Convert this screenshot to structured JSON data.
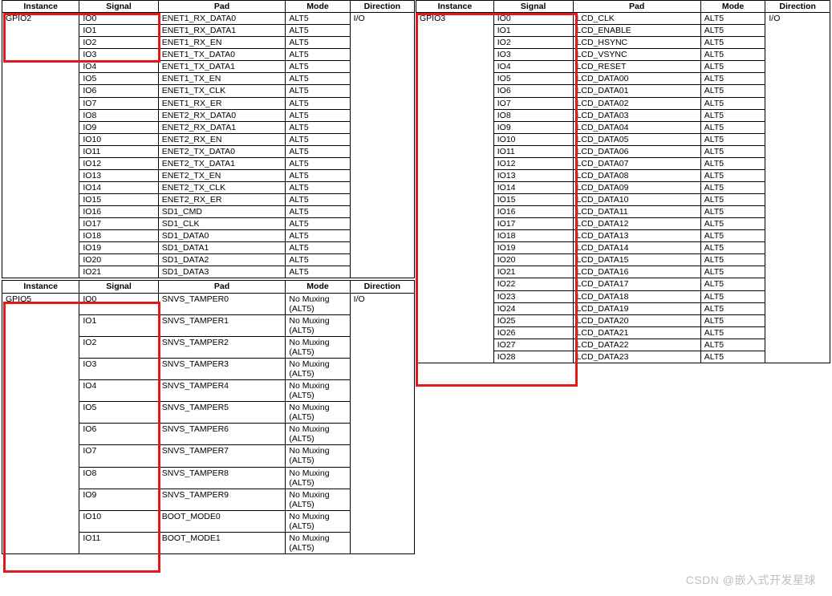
{
  "headers": {
    "instance": "Instance",
    "signal": "Signal",
    "pad": "Pad",
    "mode": "Mode",
    "direction": "Direction"
  },
  "watermark": "CSDN @嵌入式开发星球",
  "tables": {
    "t1": {
      "instance": "GPIO2",
      "direction": "I/O",
      "rows": [
        {
          "sig": "IO0",
          "pad": "ENET1_RX_DATA0",
          "mode": "ALT5"
        },
        {
          "sig": "IO1",
          "pad": "ENET1_RX_DATA1",
          "mode": "ALT5"
        },
        {
          "sig": "IO2",
          "pad": "ENET1_RX_EN",
          "mode": "ALT5"
        },
        {
          "sig": "IO3",
          "pad": "ENET1_TX_DATA0",
          "mode": "ALT5"
        },
        {
          "sig": "IO4",
          "pad": "ENET1_TX_DATA1",
          "mode": "ALT5"
        },
        {
          "sig": "IO5",
          "pad": "ENET1_TX_EN",
          "mode": "ALT5"
        },
        {
          "sig": "IO6",
          "pad": "ENET1_TX_CLK",
          "mode": "ALT5"
        },
        {
          "sig": "IO7",
          "pad": "ENET1_RX_ER",
          "mode": "ALT5"
        },
        {
          "sig": "IO8",
          "pad": "ENET2_RX_DATA0",
          "mode": "ALT5"
        },
        {
          "sig": "IO9",
          "pad": "ENET2_RX_DATA1",
          "mode": "ALT5"
        },
        {
          "sig": "IO10",
          "pad": "ENET2_RX_EN",
          "mode": "ALT5"
        },
        {
          "sig": "IO11",
          "pad": "ENET2_TX_DATA0",
          "mode": "ALT5"
        },
        {
          "sig": "IO12",
          "pad": "ENET2_TX_DATA1",
          "mode": "ALT5"
        },
        {
          "sig": "IO13",
          "pad": "ENET2_TX_EN",
          "mode": "ALT5"
        },
        {
          "sig": "IO14",
          "pad": "ENET2_TX_CLK",
          "mode": "ALT5"
        },
        {
          "sig": "IO15",
          "pad": "ENET2_RX_ER",
          "mode": "ALT5"
        },
        {
          "sig": "IO16",
          "pad": "SD1_CMD",
          "mode": "ALT5"
        },
        {
          "sig": "IO17",
          "pad": "SD1_CLK",
          "mode": "ALT5"
        },
        {
          "sig": "IO18",
          "pad": "SD1_DATA0",
          "mode": "ALT5"
        },
        {
          "sig": "IO19",
          "pad": "SD1_DATA1",
          "mode": "ALT5"
        },
        {
          "sig": "IO20",
          "pad": "SD1_DATA2",
          "mode": "ALT5"
        },
        {
          "sig": "IO21",
          "pad": "SD1_DATA3",
          "mode": "ALT5"
        }
      ]
    },
    "t2": {
      "instance": "GPIO5",
      "direction": "I/O",
      "rows": [
        {
          "sig": "IO0",
          "pad": "SNVS_TAMPER0",
          "mode": "No Muxing (ALT5)"
        },
        {
          "sig": "IO1",
          "pad": "SNVS_TAMPER1",
          "mode": "No Muxing (ALT5)"
        },
        {
          "sig": "IO2",
          "pad": "SNVS_TAMPER2",
          "mode": "No Muxing (ALT5)"
        },
        {
          "sig": "IO3",
          "pad": "SNVS_TAMPER3",
          "mode": "No Muxing (ALT5)"
        },
        {
          "sig": "IO4",
          "pad": "SNVS_TAMPER4",
          "mode": "No Muxing (ALT5)"
        },
        {
          "sig": "IO5",
          "pad": "SNVS_TAMPER5",
          "mode": "No Muxing (ALT5)"
        },
        {
          "sig": "IO6",
          "pad": "SNVS_TAMPER6",
          "mode": "No Muxing (ALT5)"
        },
        {
          "sig": "IO7",
          "pad": "SNVS_TAMPER7",
          "mode": "No Muxing (ALT5)"
        },
        {
          "sig": "IO8",
          "pad": "SNVS_TAMPER8",
          "mode": "No Muxing (ALT5)"
        },
        {
          "sig": "IO9",
          "pad": "SNVS_TAMPER9",
          "mode": "No Muxing (ALT5)"
        },
        {
          "sig": "IO10",
          "pad": "BOOT_MODE0",
          "mode": "No Muxing (ALT5)"
        },
        {
          "sig": "IO11",
          "pad": "BOOT_MODE1",
          "mode": "No Muxing (ALT5)"
        }
      ]
    },
    "t3": {
      "instance": "GPIO3",
      "direction": "I/O",
      "rows": [
        {
          "sig": "IO0",
          "pad": "LCD_CLK",
          "mode": "ALT5"
        },
        {
          "sig": "IO1",
          "pad": "LCD_ENABLE",
          "mode": "ALT5"
        },
        {
          "sig": "IO2",
          "pad": "LCD_HSYNC",
          "mode": "ALT5"
        },
        {
          "sig": "IO3",
          "pad": "LCD_VSYNC",
          "mode": "ALT5"
        },
        {
          "sig": "IO4",
          "pad": "LCD_RESET",
          "mode": "ALT5"
        },
        {
          "sig": "IO5",
          "pad": "LCD_DATA00",
          "mode": "ALT5"
        },
        {
          "sig": "IO6",
          "pad": "LCD_DATA01",
          "mode": "ALT5"
        },
        {
          "sig": "IO7",
          "pad": "LCD_DATA02",
          "mode": "ALT5"
        },
        {
          "sig": "IO8",
          "pad": "LCD_DATA03",
          "mode": "ALT5"
        },
        {
          "sig": "IO9",
          "pad": "LCD_DATA04",
          "mode": "ALT5"
        },
        {
          "sig": "IO10",
          "pad": "LCD_DATA05",
          "mode": "ALT5"
        },
        {
          "sig": "IO11",
          "pad": "LCD_DATA06",
          "mode": "ALT5"
        },
        {
          "sig": "IO12",
          "pad": "LCD_DATA07",
          "mode": "ALT5"
        },
        {
          "sig": "IO13",
          "pad": "LCD_DATA08",
          "mode": "ALT5"
        },
        {
          "sig": "IO14",
          "pad": "LCD_DATA09",
          "mode": "ALT5"
        },
        {
          "sig": "IO15",
          "pad": "LCD_DATA10",
          "mode": "ALT5"
        },
        {
          "sig": "IO16",
          "pad": "LCD_DATA11",
          "mode": "ALT5"
        },
        {
          "sig": "IO17",
          "pad": "LCD_DATA12",
          "mode": "ALT5"
        },
        {
          "sig": "IO18",
          "pad": "LCD_DATA13",
          "mode": "ALT5"
        },
        {
          "sig": "IO19",
          "pad": "LCD_DATA14",
          "mode": "ALT5"
        },
        {
          "sig": "IO20",
          "pad": "LCD_DATA15",
          "mode": "ALT5"
        },
        {
          "sig": "IO21",
          "pad": "LCD_DATA16",
          "mode": "ALT5"
        },
        {
          "sig": "IO22",
          "pad": "LCD_DATA17",
          "mode": "ALT5"
        },
        {
          "sig": "IO23",
          "pad": "LCD_DATA18",
          "mode": "ALT5"
        },
        {
          "sig": "IO24",
          "pad": "LCD_DATA19",
          "mode": "ALT5"
        },
        {
          "sig": "IO25",
          "pad": "LCD_DATA20",
          "mode": "ALT5"
        },
        {
          "sig": "IO26",
          "pad": "LCD_DATA21",
          "mode": "ALT5"
        },
        {
          "sig": "IO27",
          "pad": "LCD_DATA22",
          "mode": "ALT5"
        },
        {
          "sig": "IO28",
          "pad": "LCD_DATA23",
          "mode": "ALT5"
        }
      ]
    }
  }
}
